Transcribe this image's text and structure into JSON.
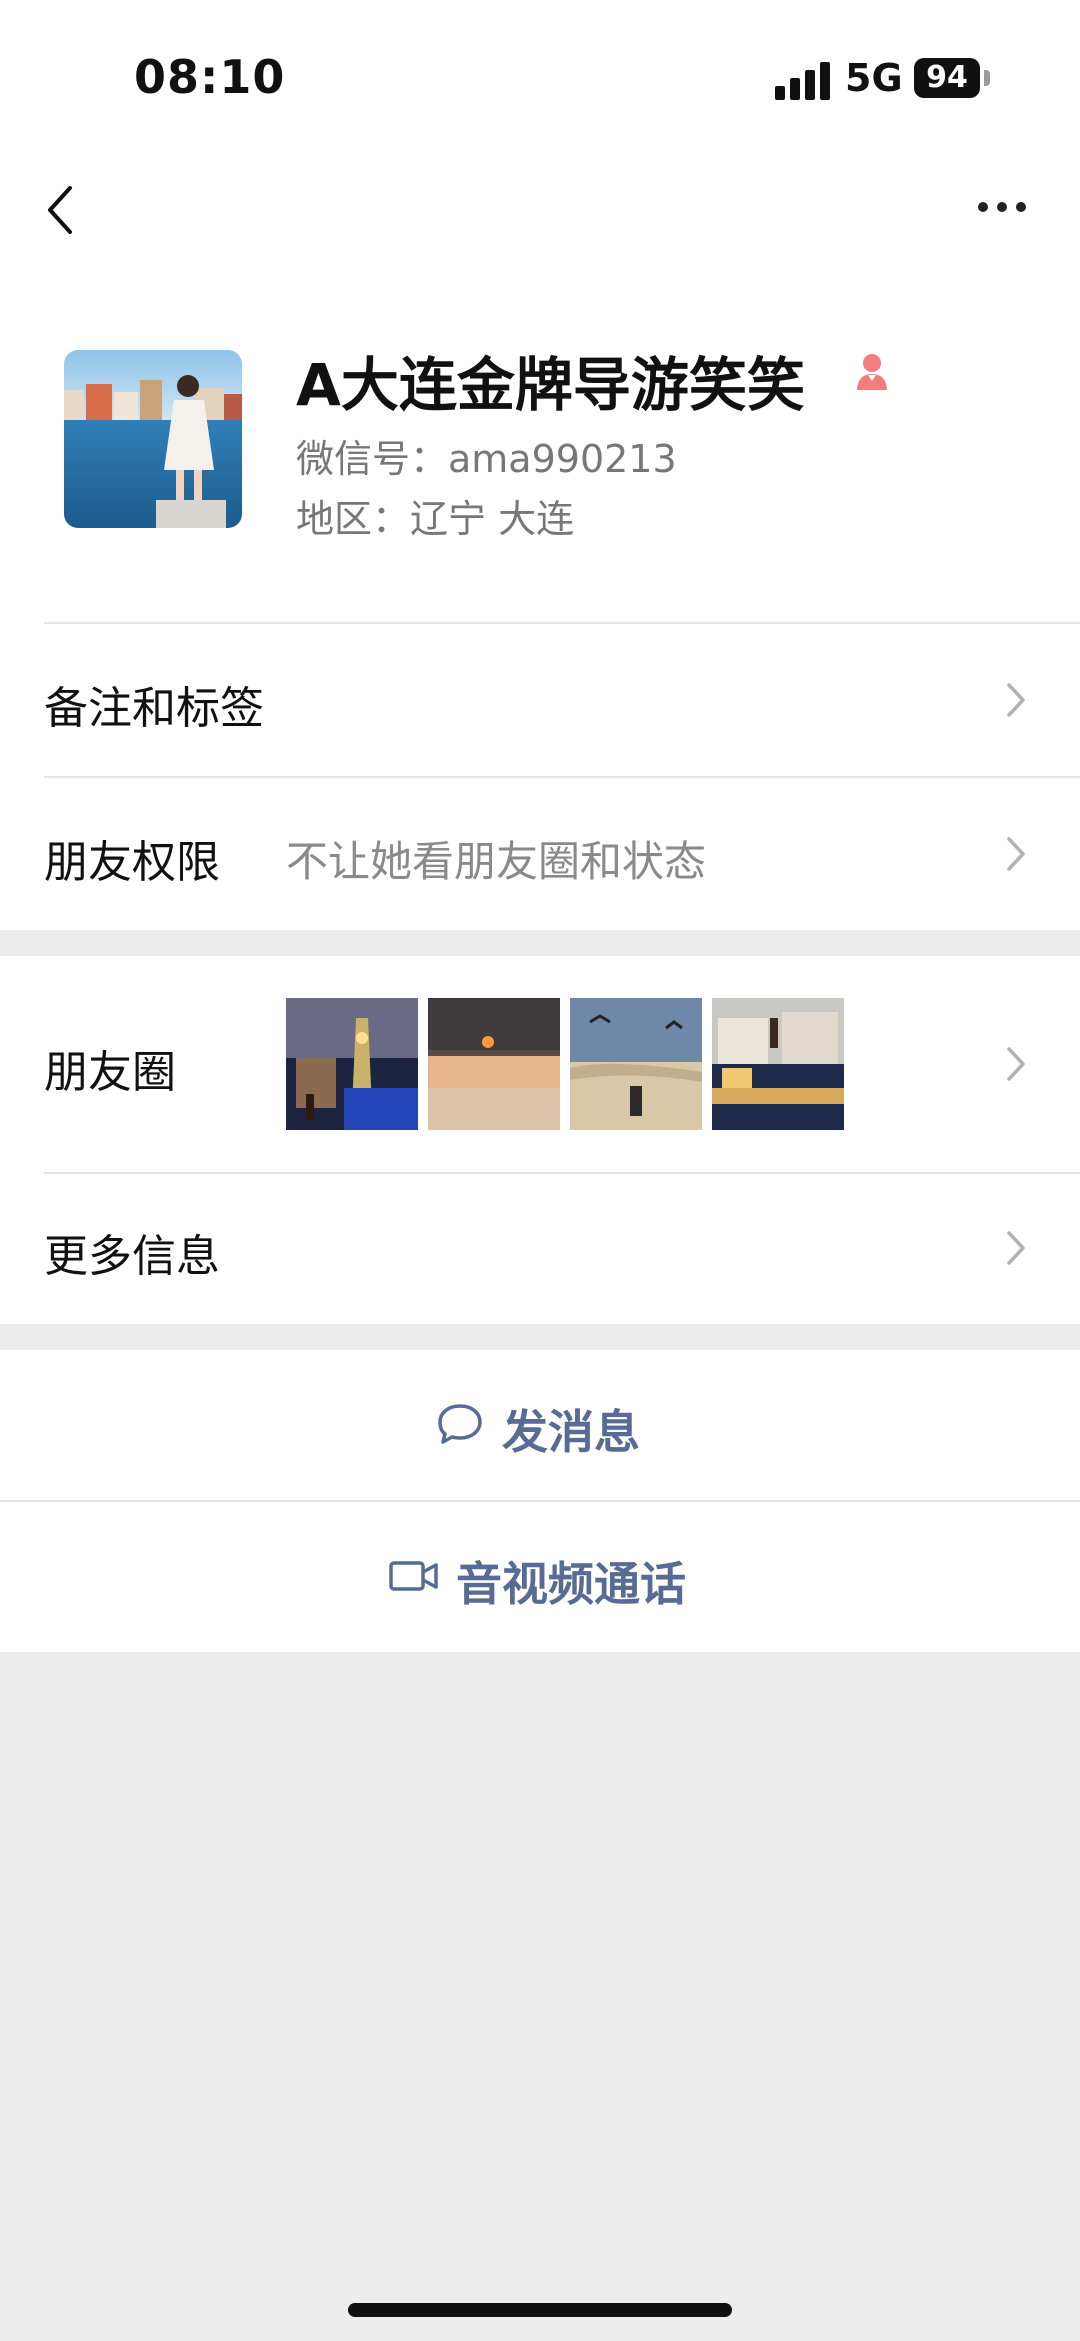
{
  "status_bar": {
    "time": "08:10",
    "network": "5G",
    "battery": "94"
  },
  "profile": {
    "name": "A大连金牌导游笑笑",
    "wechat_id": "微信号：ama990213",
    "region": "地区：辽宁 大连",
    "gender_icon": "female-icon",
    "gender_color": "#f37e7d"
  },
  "rows": {
    "remarks": {
      "label": "备注和标签"
    },
    "permissions": {
      "label": "朋友权限",
      "value": "不让她看朋友圈和状态"
    },
    "moments": {
      "label": "朋友圈",
      "thumbnails": [
        "night-castle-photo",
        "sunset-photo",
        "beach-seagull-photo",
        "evening-street-photo"
      ]
    },
    "more_info": {
      "label": "更多信息"
    }
  },
  "actions": {
    "message": {
      "label": "发消息",
      "icon": "chat-bubble-icon"
    },
    "call": {
      "label": "音视频通话",
      "icon": "video-camera-icon"
    }
  },
  "colors": {
    "accent": "#576b95",
    "background": "#ededed"
  }
}
